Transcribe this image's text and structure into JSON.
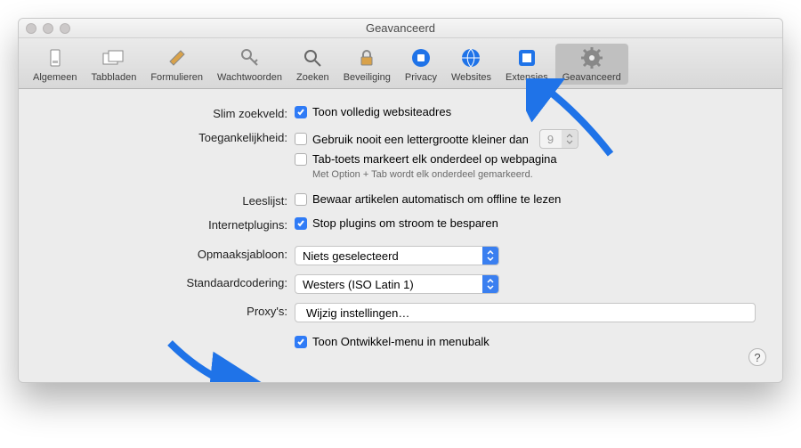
{
  "window": {
    "title": "Geavanceerd"
  },
  "toolbar": {
    "items": [
      {
        "label": "Algemeen"
      },
      {
        "label": "Tabbladen"
      },
      {
        "label": "Formulieren"
      },
      {
        "label": "Wachtwoorden"
      },
      {
        "label": "Zoeken"
      },
      {
        "label": "Beveiliging"
      },
      {
        "label": "Privacy"
      },
      {
        "label": "Websites"
      },
      {
        "label": "Extensies"
      },
      {
        "label": "Geavanceerd"
      }
    ]
  },
  "labels": {
    "slim_zoekveld": "Slim zoekveld:",
    "toegankelijkheid": "Toegankelijkheid:",
    "leeslijst": "Leeslijst:",
    "internetplugins": "Internetplugins:",
    "opmaaksjabloon": "Opmaaksjabloon:",
    "standaardcodering": "Standaardcodering:",
    "proxys": "Proxy's:"
  },
  "checks": {
    "toon_websiteadres": "Toon volledig websiteadres",
    "gebruik_nooit": "Gebruik nooit een lettergrootte kleiner dan",
    "tab_toets": "Tab-toets markeert elk onderdeel op webpagina",
    "tab_hint": "Met Option + Tab wordt elk onderdeel gemarkeerd.",
    "bewaar_artikelen": "Bewaar artikelen automatisch om offline te lezen",
    "stop_plugins": "Stop plugins om stroom te besparen",
    "toon_ontwikkel": "Toon Ontwikkel-menu in menubalk"
  },
  "selects": {
    "fontsize": "9",
    "opmaaksjabloon": "Niets geselecteerd",
    "standaardcodering": "Westers (ISO Latin 1)"
  },
  "buttons": {
    "wijzig_instellingen": "Wijzig instellingen…"
  }
}
